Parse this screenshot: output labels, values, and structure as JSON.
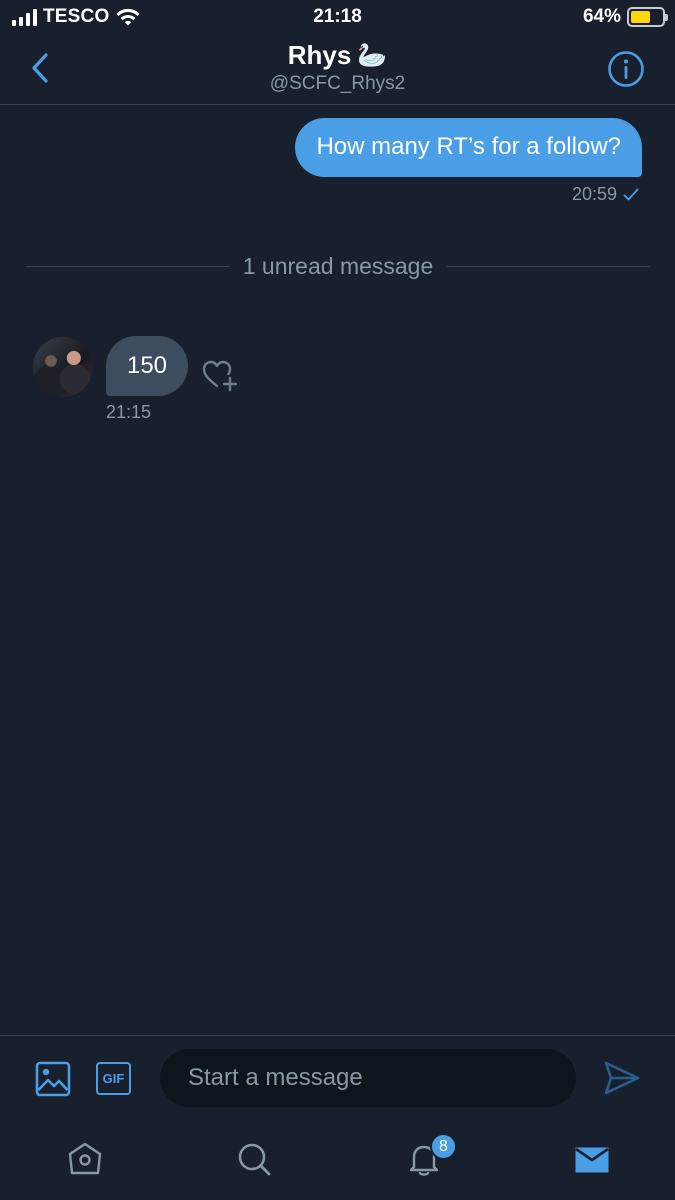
{
  "status_bar": {
    "carrier": "TESCO",
    "time": "21:18",
    "battery_percent": "64%",
    "battery_level": 0.64,
    "icons": [
      "signal-icon",
      "wifi-icon",
      "battery-icon"
    ]
  },
  "header": {
    "name": "Rhys",
    "name_emoji": "🦢",
    "handle": "@SCFC_Rhys2",
    "back_icon": "chevron-left-icon",
    "info_icon": "info-icon"
  },
  "messages": [
    {
      "direction": "sent",
      "text": "How many RT’s for a follow?",
      "time": "20:59",
      "status_icon": "checkmark-icon"
    },
    {
      "direction": "received",
      "text": "150",
      "time": "21:15",
      "like_icon": "heart-plus-icon"
    }
  ],
  "unread_divider": "1 unread message",
  "composer": {
    "placeholder": "Start a message",
    "gif_label": "GIF",
    "media_icon": "image-icon",
    "send_icon": "send-icon"
  },
  "tab_bar": {
    "tabs": [
      "home-icon",
      "search-icon",
      "notifications-icon",
      "messages-icon"
    ],
    "notifications_badge": "8",
    "active_tab": "messages"
  },
  "colors": {
    "background": "#18202d",
    "accent": "#4a9ee6",
    "received_bubble": "#3d4c5e",
    "muted_text": "#8899a6",
    "divider": "#38444d"
  }
}
